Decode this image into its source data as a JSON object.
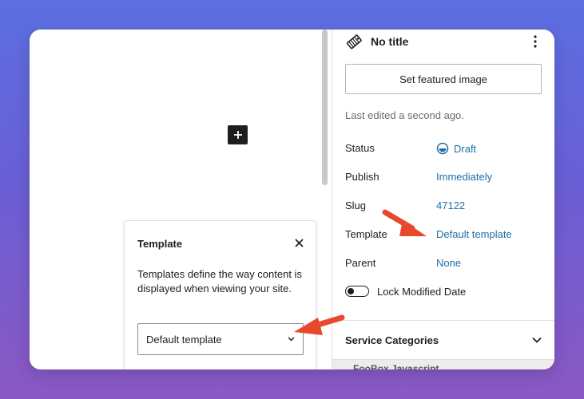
{
  "post": {
    "title": "No title"
  },
  "sidebar": {
    "featured_image_label": "Set featured image",
    "last_edited": "Last edited a second ago.",
    "rows": [
      {
        "label": "Status",
        "value": "Draft"
      },
      {
        "label": "Publish",
        "value": "Immediately"
      },
      {
        "label": "Slug",
        "value": "47122"
      },
      {
        "label": "Template",
        "value": "Default template"
      },
      {
        "label": "Parent",
        "value": "None"
      }
    ],
    "lock_modified_label": "Lock Modified Date",
    "section_title": "Service Categories",
    "partial_item": "FooBox Javascript"
  },
  "popover": {
    "title": "Template",
    "description": "Templates define the way content is displayed when viewing your site.",
    "select_value": "Default template"
  },
  "colors": {
    "link": "#1f6fa8",
    "annotation_arrow": "#e8482c",
    "text": "#1e1e1e"
  }
}
